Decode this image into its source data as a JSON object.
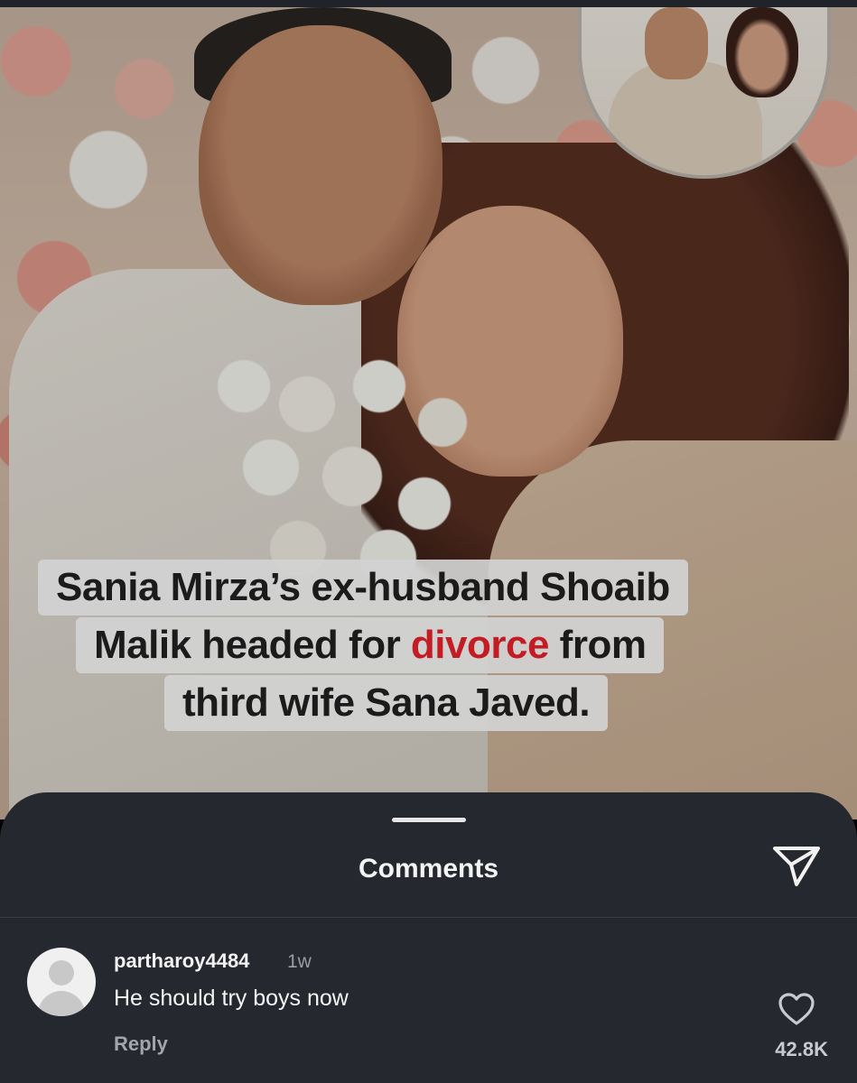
{
  "post": {
    "headline_part1": "Sania Mirza’s ex-husband Shoaib",
    "headline_part2_before": "Malik headed for ",
    "headline_part2_accent": "divorce",
    "headline_part2_after": " from",
    "headline_part3": "third wife Sana Javed.",
    "accent_color": "#c41c24"
  },
  "sheet": {
    "title": "Comments",
    "share_icon": "send-icon"
  },
  "comments": [
    {
      "username": "partharoy4484",
      "time": "1w",
      "text": "He should try boys now",
      "reply_label": "Reply",
      "likes": "42.8K",
      "like_icon": "heart-icon",
      "avatar_icon": "default-avatar-icon"
    }
  ]
}
